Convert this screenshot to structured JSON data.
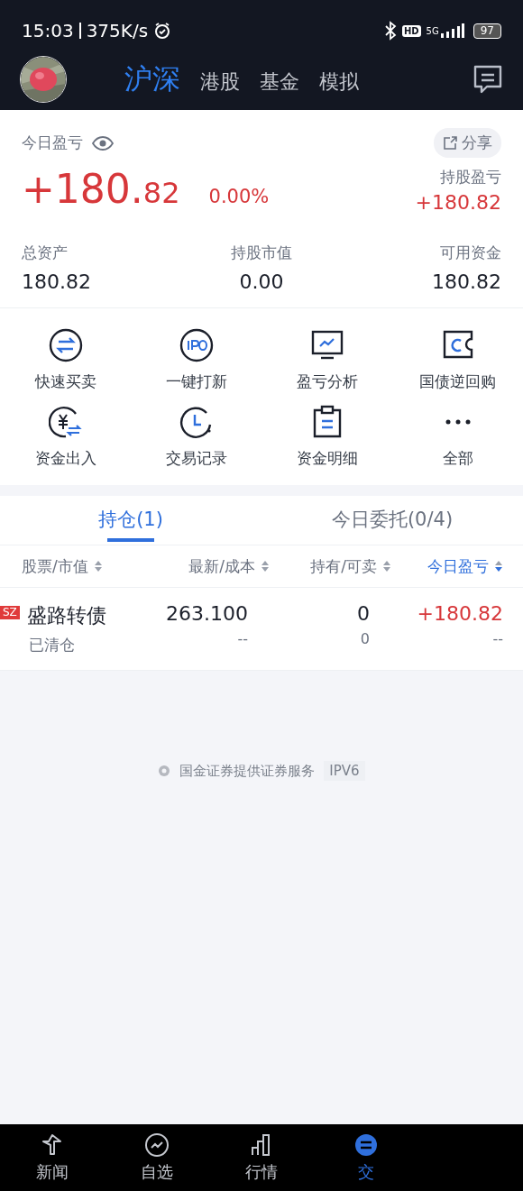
{
  "status_bar": {
    "time": "15:03",
    "speed": "375K/s",
    "hd": "HD",
    "network": "5G",
    "battery": "97"
  },
  "header": {
    "tabs": [
      {
        "label": "沪深",
        "selected": true
      },
      {
        "label": "港股",
        "selected": false
      },
      {
        "label": "基金",
        "selected": false
      },
      {
        "label": "模拟",
        "selected": false
      }
    ]
  },
  "summary": {
    "today_label": "今日盈亏",
    "share": "分享",
    "today_pl_whole": "+180.",
    "today_pl_fraction": "82",
    "today_percent": "0.00%",
    "holding_pl_label": "持股盈亏",
    "holding_pl": "+180.82",
    "stats": [
      {
        "label": "总资产",
        "value": "180.82"
      },
      {
        "label": "持股市值",
        "value": "0.00"
      },
      {
        "label": "可用资金",
        "value": "180.82"
      }
    ]
  },
  "shortcuts": [
    {
      "label": "快速买卖",
      "kind": "swap"
    },
    {
      "label": "一键打新",
      "kind": "ipo"
    },
    {
      "label": "盈亏分析",
      "kind": "monitor"
    },
    {
      "label": "国债逆回购",
      "kind": "ticket"
    },
    {
      "label": "资金出入",
      "kind": "yuan"
    },
    {
      "label": "交易记录",
      "kind": "clock"
    },
    {
      "label": "资金明细",
      "kind": "clipboard"
    },
    {
      "label": "全部",
      "kind": "more"
    }
  ],
  "position_tabs": [
    {
      "label": "持仓(1)",
      "selected": true
    },
    {
      "label": "今日委托(0/4)",
      "selected": false
    }
  ],
  "table": {
    "columns": [
      {
        "label": "股票/市值",
        "selected": false
      },
      {
        "label": "最新/成本",
        "selected": false
      },
      {
        "label": "持有/可卖",
        "selected": false
      },
      {
        "label": "今日盈亏",
        "selected": true
      }
    ],
    "rows": [
      {
        "market": "SZ",
        "name": "盛路转债",
        "status": "已清仓",
        "price": "263.100",
        "cost": "--",
        "holding": "0",
        "available": "0",
        "pl": "+180.82",
        "pl_sub": "--"
      }
    ]
  },
  "footer": {
    "text": "国金证券提供证券服务",
    "badge": "IPV6"
  },
  "bottom_nav": [
    {
      "label": "新闻",
      "kind": "news",
      "selected": false
    },
    {
      "label": "自选",
      "kind": "watch",
      "selected": false
    },
    {
      "label": "行情",
      "kind": "market",
      "selected": false
    },
    {
      "label": "交",
      "kind": "trade",
      "selected": true
    }
  ]
}
